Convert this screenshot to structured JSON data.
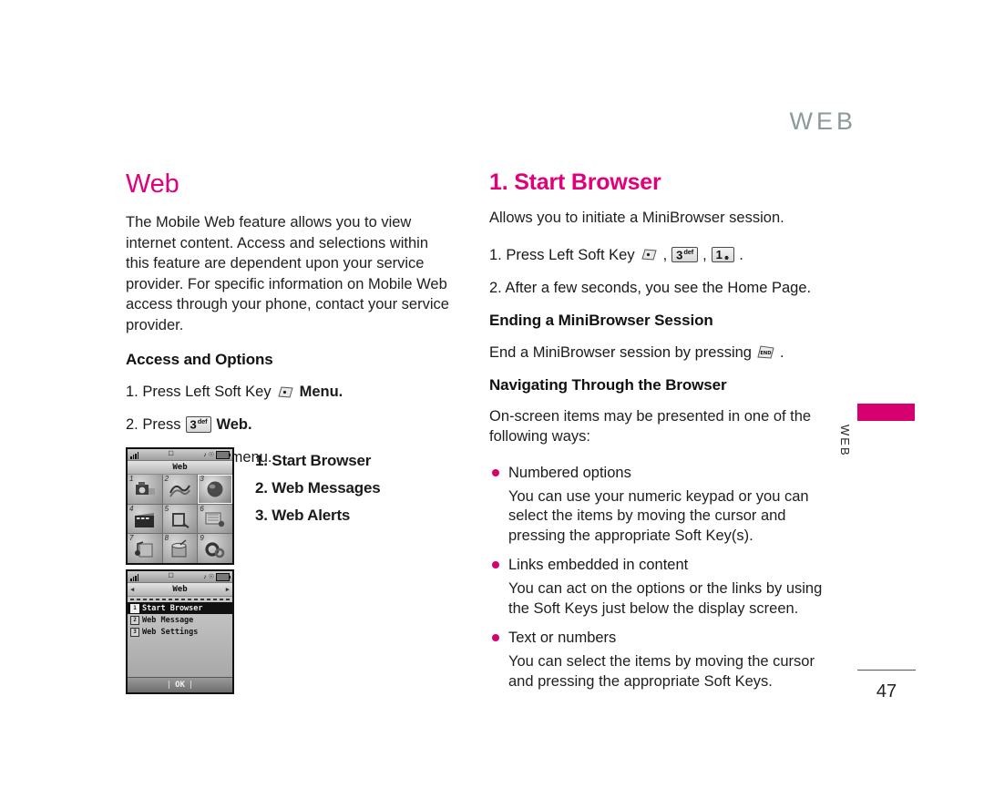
{
  "running_head": "WEB",
  "page_number": "47",
  "edge_tab": {
    "label": "WEB",
    "color": "#d6006e"
  },
  "accent_color": "#e0007a",
  "left_column": {
    "title": "Web",
    "intro": "The Mobile Web feature allows you to view internet content. Access and selections within this feature are dependent upon your service provider. For specific information on Mobile Web access through your phone, contact your service provider.",
    "subhead": "Access and Options",
    "steps": [
      {
        "num": "1.",
        "text_before": "Press Left Soft Key",
        "key": "soft-key",
        "text_after": "Menu."
      },
      {
        "num": "2.",
        "text_before": "Press",
        "key": "3def",
        "key_digit": "3",
        "key_letters": "def",
        "text_after": "Web."
      },
      {
        "num": "3.",
        "text_before": "Select a sub-menu.",
        "key": "",
        "text_after": ""
      }
    ],
    "submenu_list": [
      "1. Start Browser",
      "2. Web Messages",
      "3. Web Alerts"
    ]
  },
  "right_column": {
    "title": "1. Start Browser",
    "intro": "Allows you to initiate a MiniBrowser session.",
    "step1_prefix": "1. Press Left Soft Key",
    "step1_keys": [
      {
        "digit": "3",
        "letters": "def"
      },
      {
        "digit": "1",
        "letters": "sym"
      }
    ],
    "step2": "2. After a few seconds, you see the Home Page.",
    "subhead_ending": "Ending a MiniBrowser Session",
    "ending_text_before": "End a MiniBrowser session by pressing",
    "ending_key_label": "END",
    "ending_text_after": ".",
    "subhead_navigating": "Navigating Through the Browser",
    "nav_intro": "On-screen items may be presented in one of the following ways:",
    "bullets": [
      {
        "label": "Numbered options",
        "body": "You can use your numeric keypad or you can select the items by moving the cursor and pressing the appropriate Soft Key(s)."
      },
      {
        "label": "Links embedded in content",
        "body": "You can act on the options or the links by using the Soft Keys just below the display screen."
      },
      {
        "label": "Text or numbers",
        "body": "You can select the items by moving the cursor and pressing the appropriate Soft Keys."
      }
    ]
  },
  "phone_grid_shot": {
    "title": "Web",
    "cells": [
      "1",
      "2",
      "3",
      "4",
      "5",
      "6",
      "7",
      "8",
      "9"
    ],
    "selected_index": 2
  },
  "phone_menu_shot": {
    "title": "Web",
    "items": [
      {
        "num": "1",
        "label": "Start Browser",
        "selected": true
      },
      {
        "num": "2",
        "label": "Web Message",
        "selected": false
      },
      {
        "num": "3",
        "label": "Web Settings",
        "selected": false
      }
    ],
    "softkey_label": "OK"
  }
}
